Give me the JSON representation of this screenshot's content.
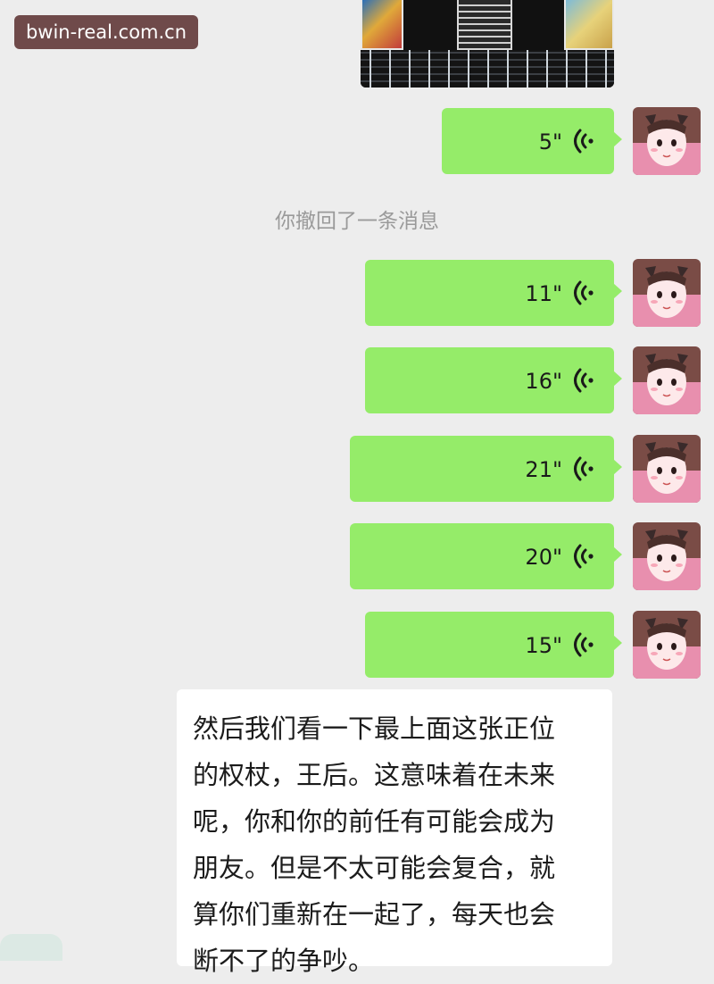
{
  "watermark": "bwin-real.com.cn",
  "recall_notice": "你撤回了一条消息",
  "voice_messages": [
    {
      "duration": "5\""
    },
    {
      "duration": "11\""
    },
    {
      "duration": "16\""
    },
    {
      "duration": "21\""
    },
    {
      "duration": "20\""
    },
    {
      "duration": "15\""
    }
  ],
  "reading_lines": [
    "然后我们看一下最上面这张正位",
    "的权杖，王后。这意味着在未来",
    "呢，你和你的前任有可能会成为",
    "朋友。但是不太可能会复合，就",
    "算你们重新在一起了，每天也会",
    "断不了的争吵。"
  ],
  "colors": {
    "background": "#ededed",
    "sent_bubble": "#95ec69",
    "received_bubble": "#ffffff",
    "watermark_bg": "#6f4a4a"
  },
  "icons": {
    "voice": "voice-wave-icon",
    "avatar": "cartoon-girl-avatar"
  }
}
